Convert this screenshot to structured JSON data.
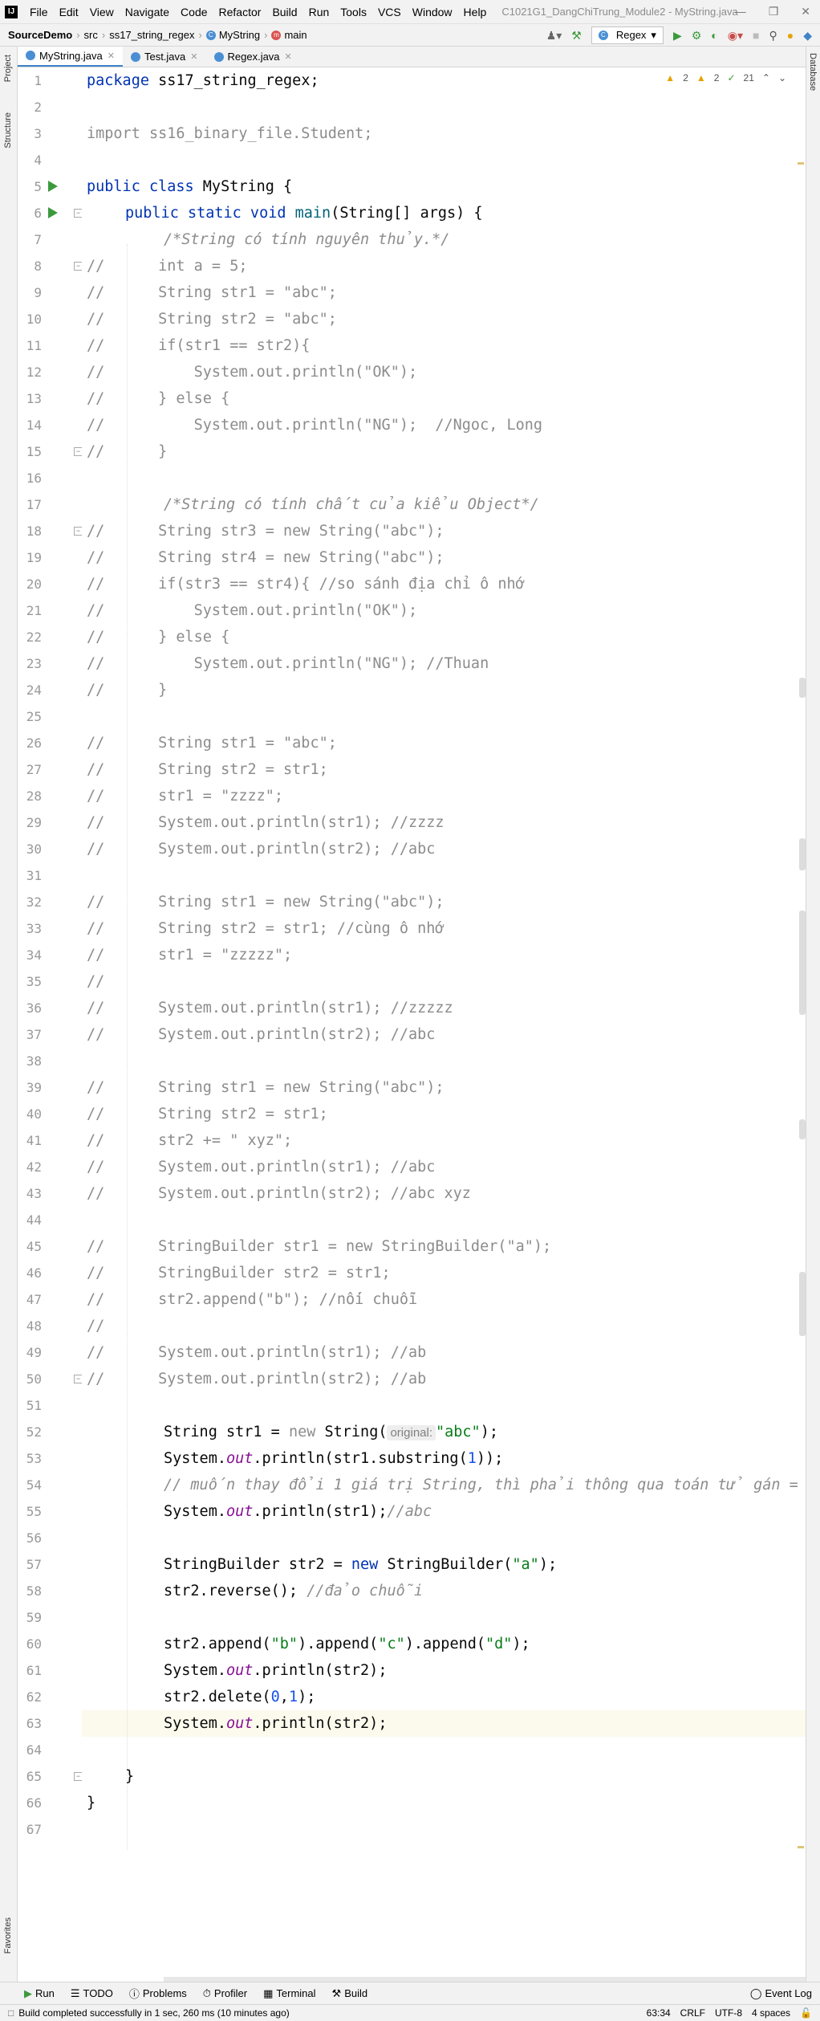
{
  "menubar": {
    "logo": "IJ",
    "items": [
      "File",
      "Edit",
      "View",
      "Navigate",
      "Code",
      "Refactor",
      "Build",
      "Run",
      "Tools",
      "VCS",
      "Window",
      "Help"
    ],
    "window_title": "C1021G1_DangChiTrung_Module2 - MyString.java"
  },
  "navbar": {
    "project": "SourceDemo",
    "crumbs": [
      "src",
      "ss17_string_regex",
      "MyString",
      "main"
    ],
    "run_config": "Regex"
  },
  "tabs": [
    {
      "label": "MyString.java",
      "active": true
    },
    {
      "label": "Test.java",
      "active": false
    },
    {
      "label": "Regex.java",
      "active": false
    }
  ],
  "inspection": {
    "warnings": "2",
    "weak_warnings": "2",
    "typos": "21"
  },
  "left_tools": {
    "project": "Project",
    "structure": "Structure",
    "favorites": "Favorites"
  },
  "right_tools": {
    "database": "Database"
  },
  "code": {
    "l1": [
      "package ",
      "ss17_string_regex;"
    ],
    "l3": "import ss16_binary_file.Student;",
    "l5": [
      "public class ",
      "MyString {"
    ],
    "l6": [
      "public static void ",
      "main",
      "(String[] args) {"
    ],
    "l7": "/*String có tính nguyên thủy.*/",
    "l8": "//      int a = 5;",
    "l9": "//      String str1 = \"abc\";",
    "l10": "//      String str2 = \"abc\";",
    "l11": "//      if(str1 == str2){",
    "l12": "//          System.out.println(\"OK\");",
    "l13": "//      } else {",
    "l14": "//          System.out.println(\"NG\");  //Ngoc, Long",
    "l15": "//      }",
    "l17": "/*String có tính chất của kiểu Object*/",
    "l18": "//      String str3 = new String(\"abc\");",
    "l19": "//      String str4 = new String(\"abc\");",
    "l20": "//      if(str3 == str4){ //so sánh địa chỉ ô nhớ",
    "l21": "//          System.out.println(\"OK\");",
    "l22": "//      } else {",
    "l23": "//          System.out.println(\"NG\"); //Thuan",
    "l24": "//      }",
    "l26": "//      String str1 = \"abc\";",
    "l27": "//      String str2 = str1;",
    "l28": "//      str1 = \"zzzz\";",
    "l29": "//      System.out.println(str1); //zzzz",
    "l30": "//      System.out.println(str2); //abc",
    "l32": "//      String str1 = new String(\"abc\");",
    "l33": "//      String str2 = str1; //cùng ô nhớ",
    "l34": "//      str1 = \"zzzzz\";",
    "l35": "//",
    "l36": "//      System.out.println(str1); //zzzzz",
    "l37": "//      System.out.println(str2); //abc",
    "l39": "//      String str1 = new String(\"abc\");",
    "l40": "//      String str2 = str1;",
    "l41": "//      str2 += \" xyz\";",
    "l42": "//      System.out.println(str1); //abc",
    "l43": "//      System.out.println(str2); //abc xyz",
    "l45": "//      StringBuilder str1 = new StringBuilder(\"a\");",
    "l46": "//      StringBuilder str2 = str1;",
    "l47": "//      str2.append(\"b\"); //nối chuỗi",
    "l48": "//",
    "l49": "//      System.out.println(str1); //ab",
    "l50": "//      System.out.println(str2); //ab",
    "l52": {
      "a": "String str1 = ",
      "b": "new ",
      "c": "String(",
      "hint": "original:",
      "d": "\"abc\"",
      "e": ");"
    },
    "l53": {
      "a": "System.",
      "b": "out",
      "c": ".println(str1.substring(",
      "d": "1",
      "e": "));"
    },
    "l54": "// muốn thay đổi 1 giá trị String, thì phải thông qua toán tử gán =",
    "l55": {
      "a": "System.",
      "b": "out",
      "c": ".println(str1);",
      "d": "//abc"
    },
    "l57": {
      "a": "StringBuilder str2 = ",
      "b": "new ",
      "c": "StringBuilder(",
      "d": "\"a\"",
      "e": ");"
    },
    "l58": {
      "a": "str2.reverse(); ",
      "b": "//đảo chuỗi"
    },
    "l60": {
      "a": "str2.append(",
      "b": "\"b\"",
      "c": ").append(",
      "d": "\"c\"",
      "e": ").append(",
      "f": "\"d\"",
      "g": ");"
    },
    "l61": {
      "a": "System.",
      "b": "out",
      "c": ".println(str2);"
    },
    "l62": {
      "a": "str2.delete(",
      "b": "0",
      "c": ",",
      "d": "1",
      "e": ");"
    },
    "l63": {
      "a": "System.",
      "b": "out",
      "c": ".println(str2);"
    },
    "l65": "}",
    "l66": "}"
  },
  "bottom_tools": [
    "Run",
    "TODO",
    "Problems",
    "Profiler",
    "Terminal",
    "Build"
  ],
  "event_log": "Event Log",
  "status": {
    "message": "Build completed successfully in 1 sec, 260 ms (10 minutes ago)",
    "position": "63:34",
    "line_sep": "CRLF",
    "encoding": "UTF-8",
    "indent": "4 spaces"
  }
}
